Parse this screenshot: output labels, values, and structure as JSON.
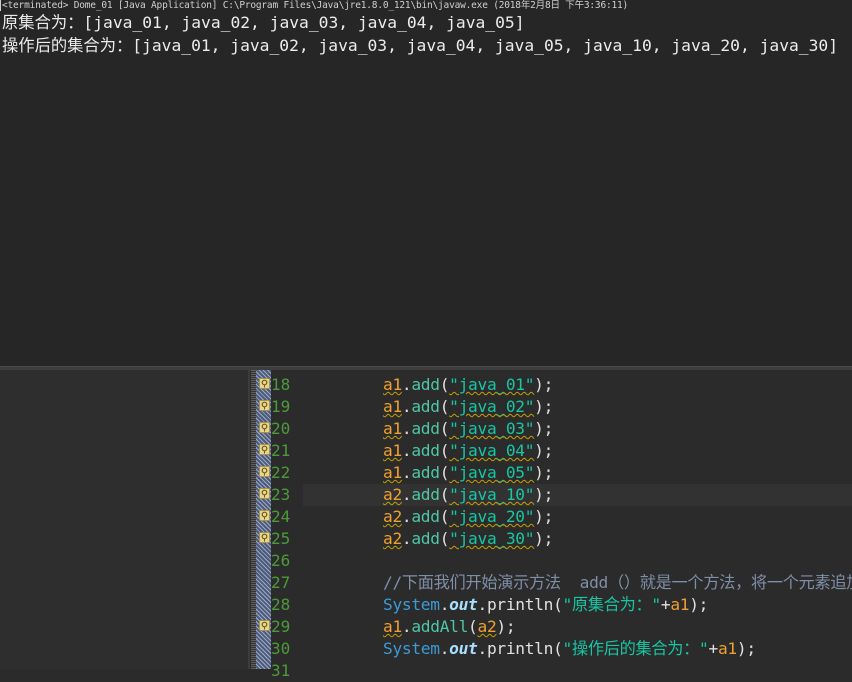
{
  "console": {
    "header": "<terminated> Dome_01 [Java Application] C:\\Program Files\\Java\\jre1.8.0_121\\bin\\javaw.exe (2018年2月8日 下午3:36:11)",
    "output": [
      "原集合为：[java_01, java_02, java_03, java_04, java_05]",
      "操作后的集合为：[java_01, java_02, java_03, java_04, java_05, java_10, java_20, java_30]"
    ]
  },
  "editor": {
    "lines": [
      {
        "num": "18",
        "var": "a1",
        "method": "add",
        "arg": "\"java_01\""
      },
      {
        "num": "19",
        "var": "a1",
        "method": "add",
        "arg": "\"java_02\""
      },
      {
        "num": "20",
        "var": "a1",
        "method": "add",
        "arg": "\"java_03\""
      },
      {
        "num": "21",
        "var": "a1",
        "method": "add",
        "arg": "\"java_04\""
      },
      {
        "num": "22",
        "var": "a1",
        "method": "add",
        "arg": "\"java_05\""
      },
      {
        "num": "23",
        "var": "a2",
        "method": "add",
        "arg": "\"java_10\""
      },
      {
        "num": "24",
        "var": "a2",
        "method": "add",
        "arg": "\"java_20\""
      },
      {
        "num": "25",
        "var": "a2",
        "method": "add",
        "arg": "\"java_30\""
      },
      {
        "num": "26"
      },
      {
        "num": "27",
        "comment": "//下面我们开始演示方法  add（）就是一个方法，将一个元素追加到"
      },
      {
        "num": "28",
        "cls": "System",
        "field": "out",
        "method": "println",
        "str": "\"原集合为：\"",
        "var": "a1"
      },
      {
        "num": "29",
        "var": "a1",
        "method": "addAll",
        "arg": "a2"
      },
      {
        "num": "30",
        "cls": "System",
        "field": "out",
        "method": "println",
        "str": "\"操作后的集合为：\"",
        "var": "a1"
      },
      {
        "num": "31"
      }
    ]
  }
}
